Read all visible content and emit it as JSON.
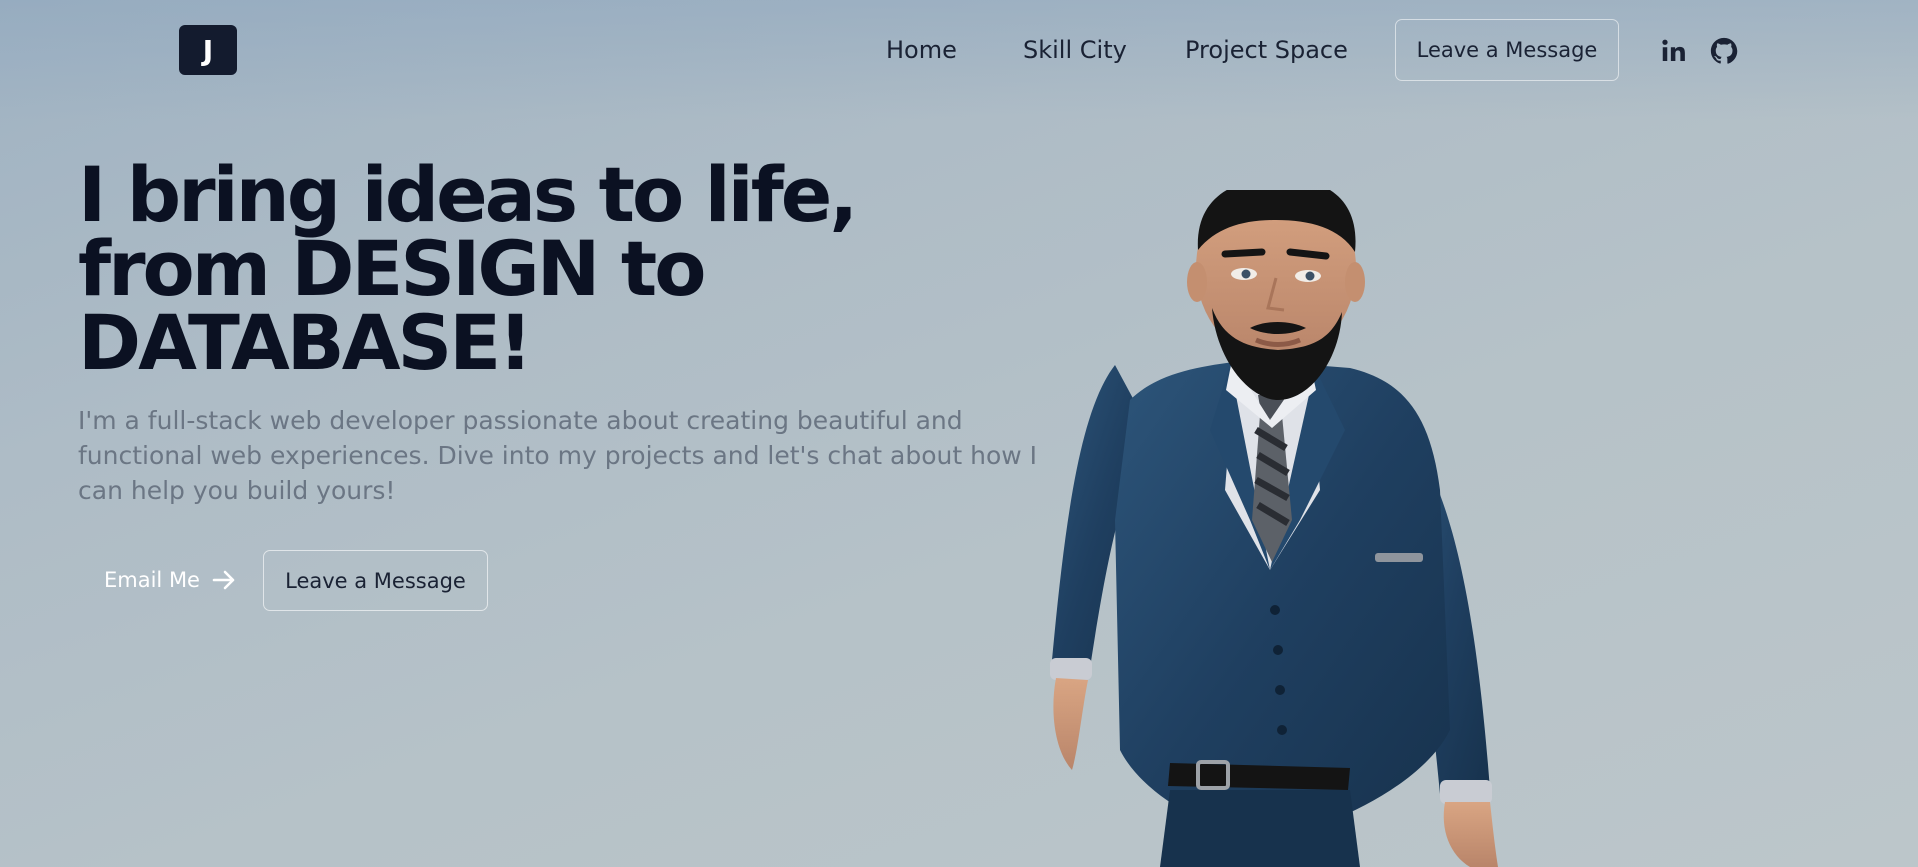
{
  "header": {
    "logo_letter": "J",
    "nav": [
      "Home",
      "Skill City",
      "Project Space"
    ],
    "cta_label": "Leave a Message",
    "social_icons": [
      "linkedin-icon",
      "github-icon"
    ]
  },
  "hero": {
    "headline_lines": [
      "I bring ideas to life,",
      "from DESIGN to",
      "DATABASE!"
    ],
    "subtext": "I'm a full-stack web developer passionate about creating beautiful and functional web experiences. Dive into my projects and let's chat about how I can help you build yours!",
    "email_label": "Email Me",
    "message_label": "Leave a Message"
  },
  "colors": {
    "logo_bg": "#131b2e",
    "headline": "#0b1122",
    "subtext": "#6b7684",
    "suit": "#1f3f60"
  }
}
